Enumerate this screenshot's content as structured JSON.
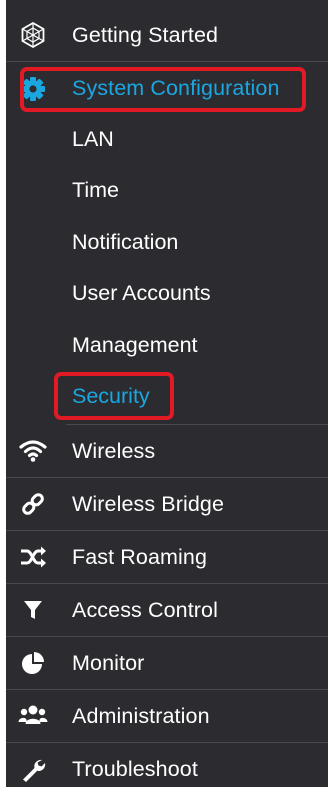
{
  "nav": {
    "getting_started": {
      "label": "Getting Started",
      "icon": "globe-icon"
    },
    "system_configuration": {
      "label": "System Configuration",
      "icon": "gear-icon",
      "subitems": [
        {
          "label": "LAN"
        },
        {
          "label": "Time"
        },
        {
          "label": "Notification"
        },
        {
          "label": "User Accounts"
        },
        {
          "label": "Management"
        },
        {
          "label": "Security"
        }
      ]
    },
    "wireless": {
      "label": "Wireless",
      "icon": "wifi-icon"
    },
    "wireless_bridge": {
      "label": "Wireless Bridge",
      "icon": "link-icon"
    },
    "fast_roaming": {
      "label": "Fast Roaming",
      "icon": "shuffle-icon"
    },
    "access_control": {
      "label": "Access Control",
      "icon": "filter-icon"
    },
    "monitor": {
      "label": "Monitor",
      "icon": "pie-chart-icon"
    },
    "administration": {
      "label": "Administration",
      "icon": "users-icon"
    },
    "troubleshoot": {
      "label": "Troubleshoot",
      "icon": "wrench-icon"
    }
  },
  "colors": {
    "sidebar_bg": "#2c2c30",
    "text": "#ffffff",
    "active_text": "#1aa7e1",
    "highlight_border": "#e21a25"
  }
}
